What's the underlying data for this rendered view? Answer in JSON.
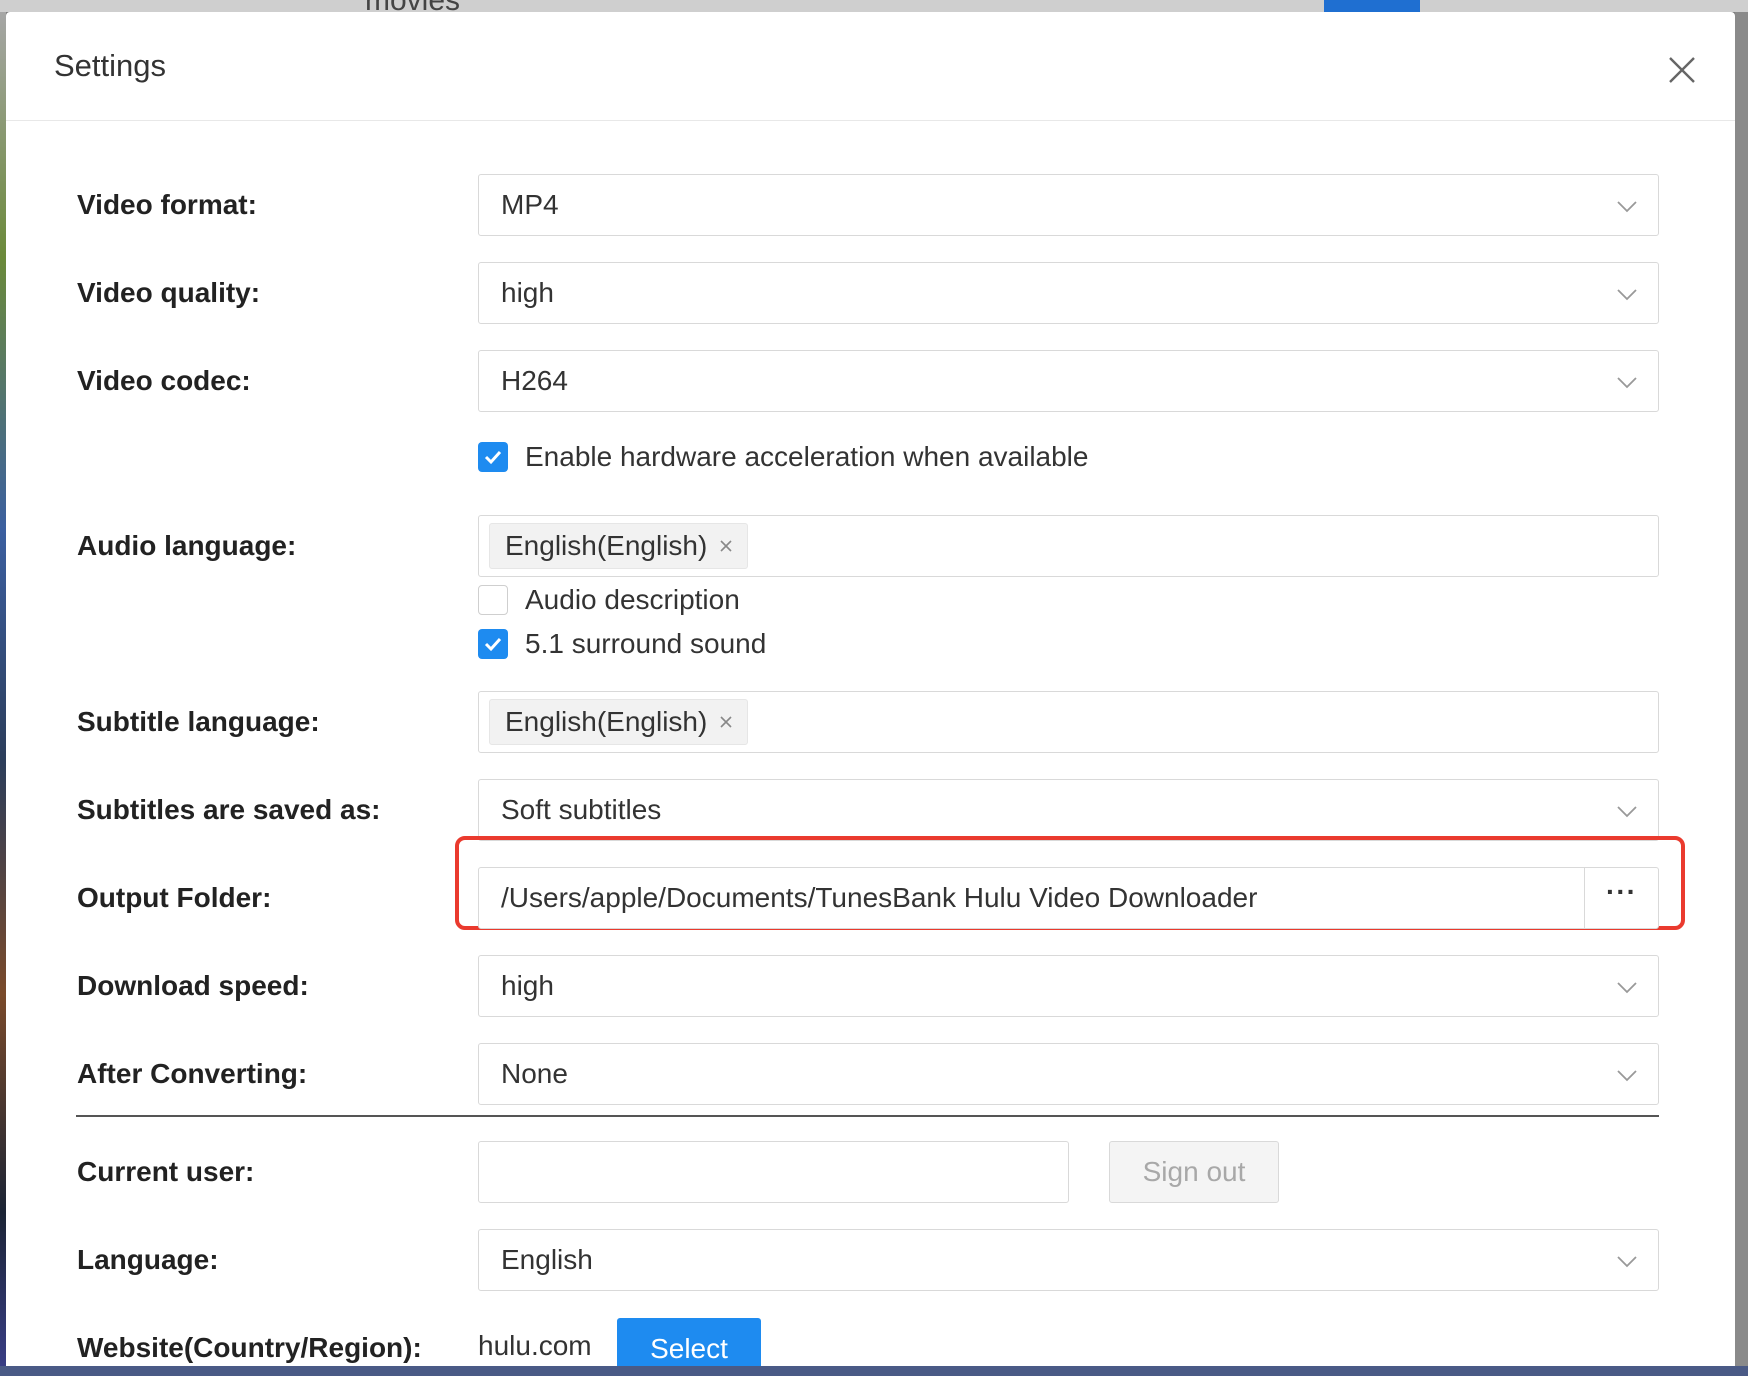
{
  "background": {
    "search_text": "movies"
  },
  "dialog": {
    "title": "Settings"
  },
  "settings": {
    "video_format": {
      "label": "Video format:",
      "value": "MP4"
    },
    "video_quality": {
      "label": "Video quality:",
      "value": "high"
    },
    "video_codec": {
      "label": "Video codec:",
      "value": "H264",
      "hw_accel": {
        "label": "Enable hardware acceleration when available",
        "checked": true
      }
    },
    "audio_language": {
      "label": "Audio language:",
      "tags": [
        "English(English)"
      ],
      "audio_description": {
        "label": "Audio description",
        "checked": false
      },
      "surround": {
        "label": "5.1 surround sound",
        "checked": true
      }
    },
    "subtitle_language": {
      "label": "Subtitle language:",
      "tags": [
        "English(English)"
      ]
    },
    "subtitles_saved_as": {
      "label": "Subtitles are saved as:",
      "value": "Soft subtitles"
    },
    "output_folder": {
      "label": "Output Folder:",
      "value": "/Users/apple/Documents/TunesBank Hulu Video Downloader",
      "browse_label": "···"
    },
    "download_speed": {
      "label": "Download speed:",
      "value": "high"
    },
    "after_converting": {
      "label": "After Converting:",
      "value": "None"
    }
  },
  "account": {
    "current_user": {
      "label": "Current user:",
      "value": ""
    },
    "sign_out_label": "Sign out",
    "language": {
      "label": "Language:",
      "value": "English"
    },
    "website": {
      "label": "Website(Country/Region):",
      "value": "hulu.com",
      "select_label": "Select"
    }
  },
  "colors": {
    "accent": "#1e8bf0",
    "highlight": "#ea3a2e"
  },
  "icons": {
    "close": "close-icon",
    "chevron": "chevron-down-icon",
    "check": "check-icon",
    "tag_remove": "tag-remove-icon"
  }
}
